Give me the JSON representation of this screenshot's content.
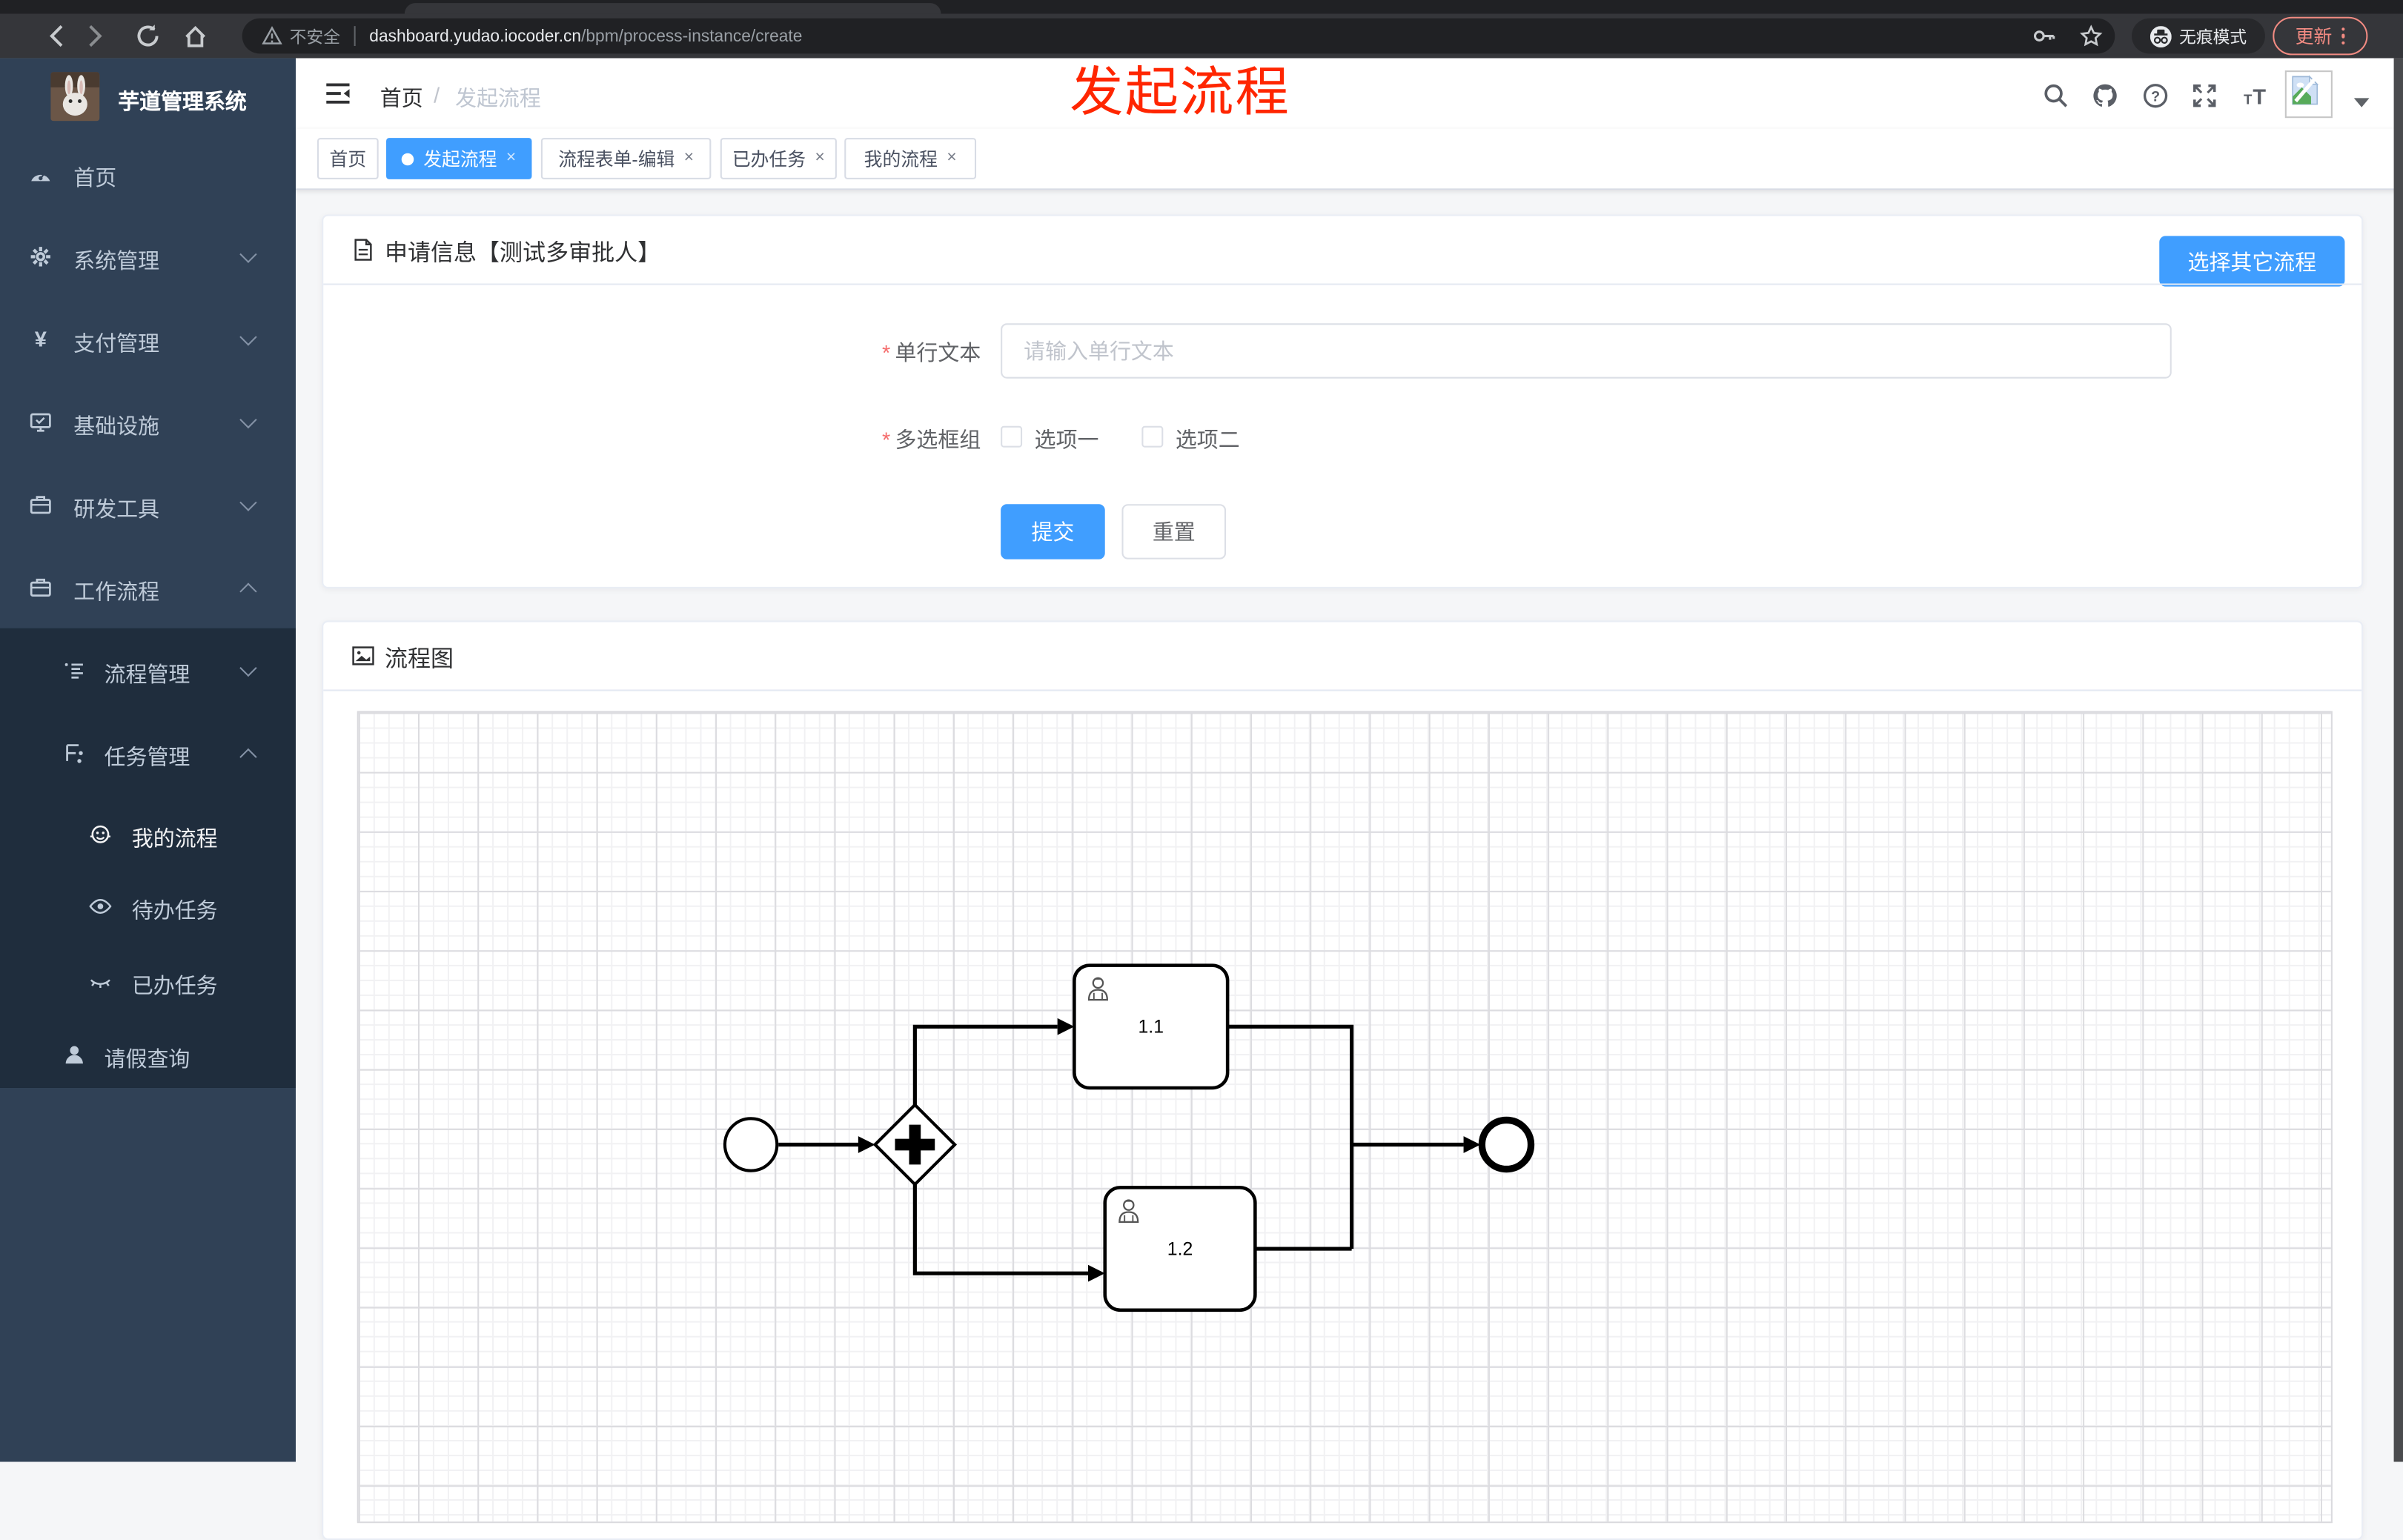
{
  "browser": {
    "security_label": "不安全",
    "url_host": "dashboard.yudao.iocoder.cn",
    "url_path": "/bpm/process-instance/create",
    "incognito_label": "无痕模式",
    "update_label": "更新"
  },
  "annotation": {
    "text": "发起流程",
    "color": "#ff2600"
  },
  "sidebar": {
    "app_title": "芋道管理系统",
    "items": [
      {
        "label": "首页"
      },
      {
        "label": "系统管理"
      },
      {
        "label": "支付管理"
      },
      {
        "label": "基础设施"
      },
      {
        "label": "研发工具"
      },
      {
        "label": "工作流程"
      }
    ],
    "submenu": [
      {
        "label": "流程管理"
      },
      {
        "label": "任务管理"
      },
      {
        "label": "我的流程"
      },
      {
        "label": "待办任务"
      },
      {
        "label": "已办任务"
      },
      {
        "label": "请假查询"
      }
    ]
  },
  "header": {
    "breadcrumb": {
      "home": "首页",
      "separator": "/",
      "current": "发起流程"
    },
    "tabs": [
      {
        "label": "首页"
      },
      {
        "label": "发起流程"
      },
      {
        "label": "流程表单-编辑"
      },
      {
        "label": "已办任务"
      },
      {
        "label": "我的流程"
      }
    ]
  },
  "form_card": {
    "title": "申请信息【测试多审批人】",
    "choose_button": "选择其它流程",
    "required_marker": "*",
    "fields": [
      {
        "label": "单行文本",
        "placeholder": "请输入单行文本"
      },
      {
        "label": "多选框组",
        "options": [
          "选项一",
          "选项二"
        ]
      }
    ],
    "submit_label": "提交",
    "reset_label": "重置"
  },
  "diagram_card": {
    "title": "流程图",
    "tasks": [
      {
        "label": "1.1"
      },
      {
        "label": "1.2"
      }
    ]
  },
  "colors": {
    "accent_blue": "#409eff",
    "sidebar_bg": "#304156",
    "submenu_bg": "#1f2d3d",
    "annotation_red": "#ff2600",
    "chrome_bg": "#35363a",
    "update_red": "#f28b82"
  }
}
